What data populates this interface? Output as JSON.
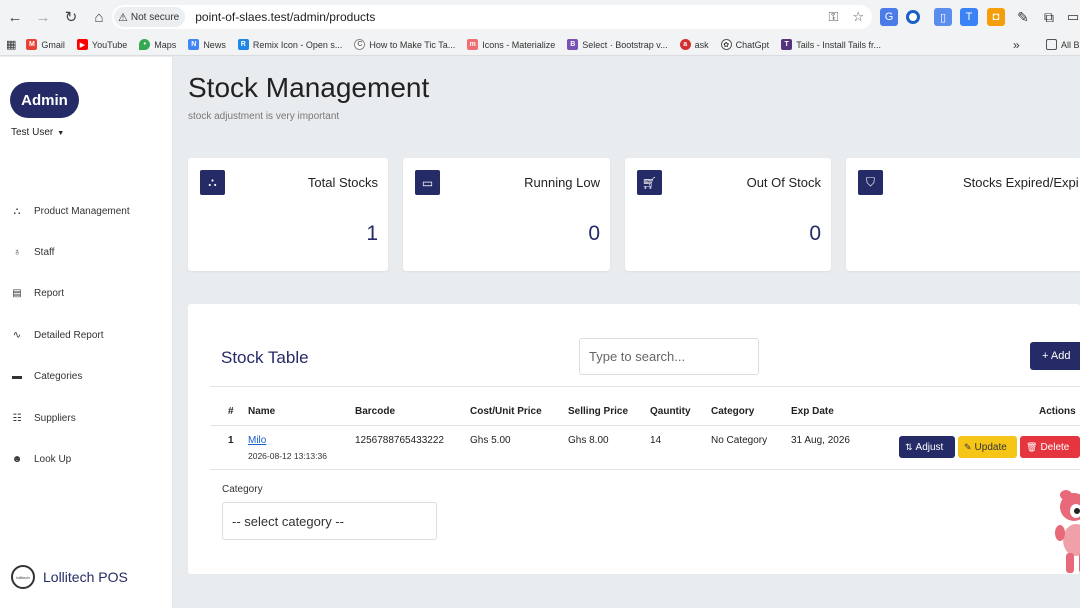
{
  "browser": {
    "security_label": "Not secure",
    "url": "point-of-slaes.test/admin/products",
    "bookmarks": [
      "Gmail",
      "YouTube",
      "Maps",
      "News",
      "Remix Icon - Open s...",
      "How to Make Tic Ta...",
      "Icons - Materialize",
      "Select · Bootstrap v...",
      "ask",
      "ChatGpt",
      "Tails - Install Tails fr..."
    ],
    "bookmarks_more": "»",
    "all_bookmarks": "All B"
  },
  "sidebar": {
    "admin_label": "Admin",
    "user_name": "Test User",
    "items": [
      {
        "label": "Product Management",
        "icon": "sitemap-icon"
      },
      {
        "label": "Staff",
        "icon": "lightbulb-icon"
      },
      {
        "label": "Report",
        "icon": "report-icon"
      },
      {
        "label": "Detailed Report",
        "icon": "pulse-icon"
      },
      {
        "label": "Categories",
        "icon": "briefcase-icon"
      },
      {
        "label": "Suppliers",
        "icon": "list-icon"
      },
      {
        "label": "Look Up",
        "icon": "users-icon"
      }
    ],
    "brand_name": "Lollitech POS",
    "brand_logo_text": "lollitech"
  },
  "page": {
    "title": "Stock Management",
    "subtitle": "stock adjustment is very important"
  },
  "cards": [
    {
      "title": "Total Stocks",
      "value": "1",
      "icon": "sitemap-icon"
    },
    {
      "title": "Running Low",
      "value": "0",
      "icon": "battery-low-icon"
    },
    {
      "title": "Out Of Stock",
      "value": "0",
      "icon": "cart-icon"
    },
    {
      "title": "Stocks Expired/Expi",
      "value": "",
      "icon": "shield-icon"
    }
  ],
  "table": {
    "title": "Stock Table",
    "search_placeholder": "Type to search...",
    "add_label": "+ Add",
    "headers": {
      "num": "#",
      "name": "Name",
      "barcode": "Barcode",
      "cost": "Cost/Unit Price",
      "selling": "Selling Price",
      "quantity": "Qauntity",
      "category": "Category",
      "exp": "Exp Date",
      "actions": "Actions"
    },
    "rows": [
      {
        "num": "1",
        "name": "Milo",
        "date": "2026-08-12 13:13:36",
        "barcode": "1256788765433222",
        "cost": "Ghs 5.00",
        "selling": "Ghs 8.00",
        "quantity": "14",
        "category": "No Category",
        "exp": "31 Aug, 2026"
      }
    ],
    "actions": {
      "adjust": "Adjust",
      "update": "Update",
      "delete": "Delete"
    },
    "category_filter_label": "Category",
    "category_filter_value": "-- select category --"
  },
  "colors": {
    "primary": "#252b66",
    "warning": "#f5c518",
    "danger": "#e5353f",
    "link": "#1a5fc7",
    "page_bg": "#e9ecef"
  }
}
